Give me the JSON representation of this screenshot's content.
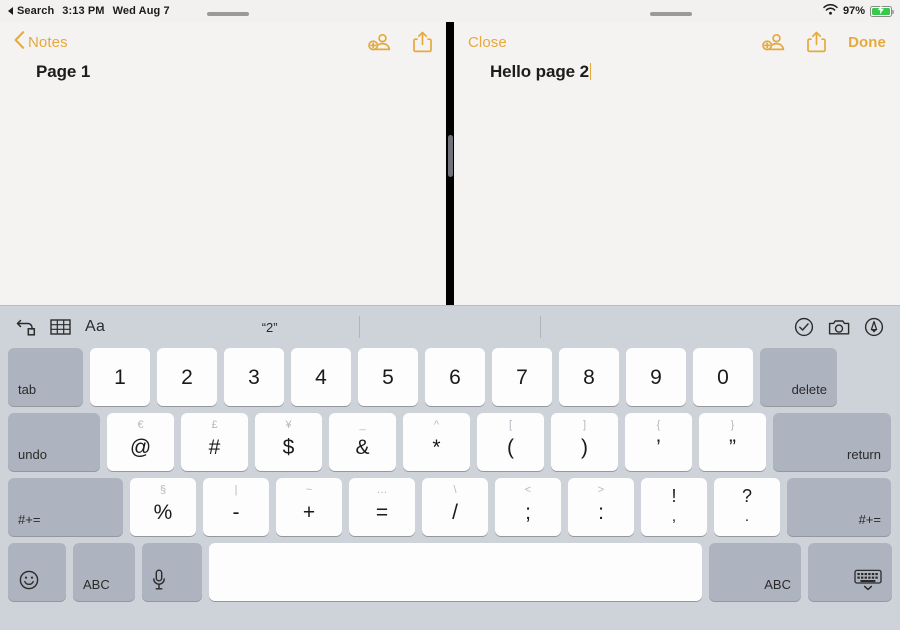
{
  "status_bar": {
    "back_app_label": "Search",
    "time": "3:13 PM",
    "date": "Wed Aug 7",
    "battery_percent": "97%",
    "wifi_icon": "wifi-icon",
    "battery_icon": "battery-charging-icon"
  },
  "left_pane": {
    "back_label": "Notes",
    "collaborate_icon": "add-person-icon",
    "share_icon": "share-icon",
    "note_title": "Page 1"
  },
  "right_pane": {
    "close_label": "Close",
    "collaborate_icon": "add-person-icon",
    "share_icon": "share-icon",
    "done_label": "Done",
    "note_title": "Hello page 2"
  },
  "keyboard_toolbar": {
    "checklist_icon": "checklist-icon",
    "table_icon": "table-icon",
    "format_label": "Aa",
    "predictions": [
      "“2”",
      "",
      ""
    ],
    "markup_check_icon": "check-circle-icon",
    "camera_icon": "camera-icon",
    "pen_icon": "markup-pen-icon"
  },
  "keyboard": {
    "rows": [
      {
        "name": "number-row",
        "keys": [
          {
            "name": "tab",
            "label": "tab",
            "style": "dark",
            "width": "k-tab",
            "align": "bl"
          },
          {
            "name": "1",
            "label": "1",
            "style": "light",
            "width": "k-num"
          },
          {
            "name": "2",
            "label": "2",
            "style": "light",
            "width": "k-num"
          },
          {
            "name": "3",
            "label": "3",
            "style": "light",
            "width": "k-num"
          },
          {
            "name": "4",
            "label": "4",
            "style": "light",
            "width": "k-num"
          },
          {
            "name": "5",
            "label": "5",
            "style": "light",
            "width": "k-num"
          },
          {
            "name": "6",
            "label": "6",
            "style": "light",
            "width": "k-num"
          },
          {
            "name": "7",
            "label": "7",
            "style": "light",
            "width": "k-num"
          },
          {
            "name": "8",
            "label": "8",
            "style": "light",
            "width": "k-num"
          },
          {
            "name": "9",
            "label": "9",
            "style": "light",
            "width": "k-num"
          },
          {
            "name": "0",
            "label": "0",
            "style": "light",
            "width": "k-num"
          },
          {
            "name": "delete",
            "label": "delete",
            "style": "dark",
            "width": "k-del",
            "align": "br"
          }
        ]
      },
      {
        "name": "symbol-row-1",
        "keys": [
          {
            "name": "undo",
            "label": "undo",
            "style": "dark",
            "width": "k-undo",
            "align": "bl"
          },
          {
            "name": "at",
            "label": "@",
            "alt": "€",
            "style": "light",
            "width": "k-sym"
          },
          {
            "name": "hash",
            "label": "#",
            "alt": "£",
            "style": "light",
            "width": "k-sym"
          },
          {
            "name": "dollar",
            "label": "$",
            "alt": "¥",
            "style": "light",
            "width": "k-sym"
          },
          {
            "name": "ampersand",
            "label": "&",
            "alt": "_",
            "style": "light",
            "width": "k-sym"
          },
          {
            "name": "asterisk",
            "label": "*",
            "alt": "^",
            "style": "light",
            "width": "k-sym"
          },
          {
            "name": "paren-open",
            "label": "(",
            "alt": "[",
            "style": "light",
            "width": "k-sym"
          },
          {
            "name": "paren-close",
            "label": ")",
            "alt": "]",
            "style": "light",
            "width": "k-sym"
          },
          {
            "name": "apostrophe",
            "label": "’",
            "alt": "{",
            "style": "light",
            "width": "k-sym"
          },
          {
            "name": "quote",
            "label": "”",
            "alt": "}",
            "style": "light",
            "width": "k-sym"
          },
          {
            "name": "return",
            "label": "return",
            "style": "dark",
            "width": "k-ret",
            "align": "br"
          }
        ]
      },
      {
        "name": "symbol-row-2",
        "keys": [
          {
            "name": "shift-left",
            "label": "#+=",
            "style": "dark",
            "width": "k-shift-l",
            "align": "bl"
          },
          {
            "name": "percent",
            "label": "%",
            "alt": "§",
            "style": "light",
            "width": "k-r3"
          },
          {
            "name": "hyphen",
            "label": "-",
            "alt": "|",
            "style": "light",
            "width": "k-r3"
          },
          {
            "name": "plus",
            "label": "+",
            "alt": "~",
            "style": "light",
            "width": "k-r3"
          },
          {
            "name": "equals",
            "label": "=",
            "alt": "…",
            "style": "light",
            "width": "k-r3"
          },
          {
            "name": "slash",
            "label": "/",
            "alt": "\\",
            "style": "light",
            "width": "k-r3"
          },
          {
            "name": "semicolon",
            "label": ";",
            "alt": "<",
            "style": "light",
            "width": "k-r3"
          },
          {
            "name": "colon",
            "label": ":",
            "alt": ">",
            "style": "light",
            "width": "k-r3"
          },
          {
            "name": "comma",
            "label": ",",
            "alt": "!",
            "alt_dark": true,
            "style": "light",
            "width": "k-r3"
          },
          {
            "name": "period",
            "label": ".",
            "alt": "?",
            "alt_dark": true,
            "style": "light",
            "width": "k-r3"
          },
          {
            "name": "shift-right",
            "label": "#+=",
            "style": "dark",
            "width": "k-shift-r",
            "align": "br"
          }
        ]
      },
      {
        "name": "bottom-row",
        "keys": [
          {
            "name": "emoji",
            "label": "",
            "icon": "emoji-icon",
            "style": "dark",
            "width": "k-emoji",
            "align": "bl"
          },
          {
            "name": "abc-left",
            "label": "ABC",
            "style": "dark",
            "width": "k-abc",
            "align": "bl"
          },
          {
            "name": "dictation",
            "label": "",
            "icon": "microphone-icon",
            "style": "dark",
            "width": "k-mic",
            "align": "bl"
          },
          {
            "name": "space",
            "label": "",
            "style": "light",
            "width": "k-space"
          },
          {
            "name": "abc-right",
            "label": "ABC",
            "style": "dark",
            "width": "k-abc2",
            "align": "br"
          },
          {
            "name": "dismiss-keyboard",
            "label": "",
            "icon": "hide-keyboard-icon",
            "style": "dark",
            "width": "k-dismiss",
            "align": "br"
          }
        ]
      }
    ]
  },
  "colors": {
    "accent": "#e5a93c",
    "keyboard_bg": "#ced2d9",
    "key_light": "#fdfdfd",
    "key_dark": "#aeb4bf",
    "battery_green": "#37c94a",
    "pane_bg": "#f4f3f1"
  }
}
